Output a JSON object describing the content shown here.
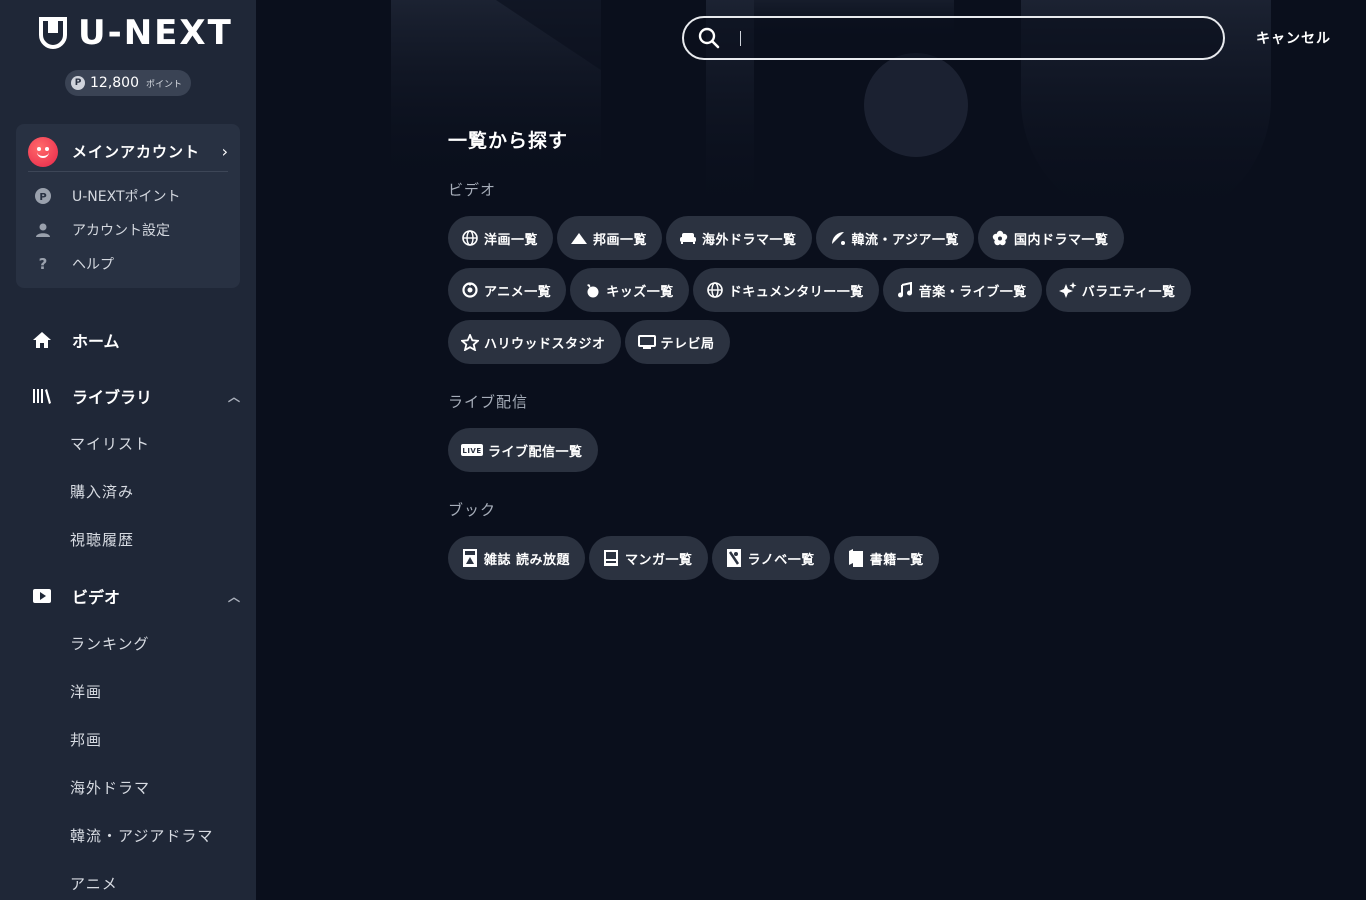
{
  "brand": {
    "logo_text": "U-NEXT"
  },
  "points": {
    "badge": "P",
    "amount": "12,800",
    "unit": "ポイント"
  },
  "account": {
    "name": "メインアカウント",
    "links": [
      {
        "label": "U-NEXTポイント",
        "icon": "points-icon"
      },
      {
        "label": "アカウント設定",
        "icon": "person-icon"
      },
      {
        "label": "ヘルプ",
        "icon": "help-icon"
      }
    ]
  },
  "nav": {
    "home": "ホーム",
    "library": {
      "label": "ライブラリ",
      "items": [
        "マイリスト",
        "購入済み",
        "視聴履歴"
      ]
    },
    "video": {
      "label": "ビデオ",
      "items": [
        "ランキング",
        "洋画",
        "邦画",
        "海外ドラマ",
        "韓流・アジアドラマ",
        "アニメ"
      ]
    }
  },
  "search": {
    "value": "",
    "placeholder": ""
  },
  "cancel_label": "キャンセル",
  "browse": {
    "title": "一覧から探す",
    "categories": [
      {
        "label": "ビデオ",
        "rows": [
          [
            {
              "label": "洋画一覧",
              "icon": "globe-icon"
            },
            {
              "label": "邦画一覧",
              "icon": "mountain-icon"
            },
            {
              "label": "海外ドラマ一覧",
              "icon": "sofa-icon"
            },
            {
              "label": "韓流・アジア一覧",
              "icon": "fan-icon"
            },
            {
              "label": "国内ドラマ一覧",
              "icon": "flower-icon"
            }
          ],
          [
            {
              "label": "アニメ一覧",
              "icon": "anime-icon"
            },
            {
              "label": "キッズ一覧",
              "icon": "kids-icon"
            },
            {
              "label": "ドキュメンタリー一覧",
              "icon": "globe-icon"
            },
            {
              "label": "音楽・ライブ一覧",
              "icon": "music-icon"
            },
            {
              "label": "バラエティ一覧",
              "icon": "sparkle-icon"
            }
          ],
          [
            {
              "label": "ハリウッドスタジオ",
              "icon": "star-icon"
            },
            {
              "label": "テレビ局",
              "icon": "tv-icon"
            }
          ]
        ]
      },
      {
        "label": "ライブ配信",
        "rows": [
          [
            {
              "label": "ライブ配信一覧",
              "icon": "live-icon",
              "icon_text": "LIVE"
            }
          ]
        ]
      },
      {
        "label": "ブック",
        "rows": [
          [
            {
              "label": "雑誌 読み放題",
              "icon": "magazine-icon"
            },
            {
              "label": "マンガ一覧",
              "icon": "manga-icon"
            },
            {
              "label": "ラノベ一覧",
              "icon": "novel-icon"
            },
            {
              "label": "書籍一覧",
              "icon": "book-icon"
            }
          ]
        ]
      }
    ]
  },
  "colors": {
    "sidebar": "#1f2737",
    "background": "#0a0f1c",
    "chip": "#2b3240",
    "avatar": "#e8264a"
  }
}
